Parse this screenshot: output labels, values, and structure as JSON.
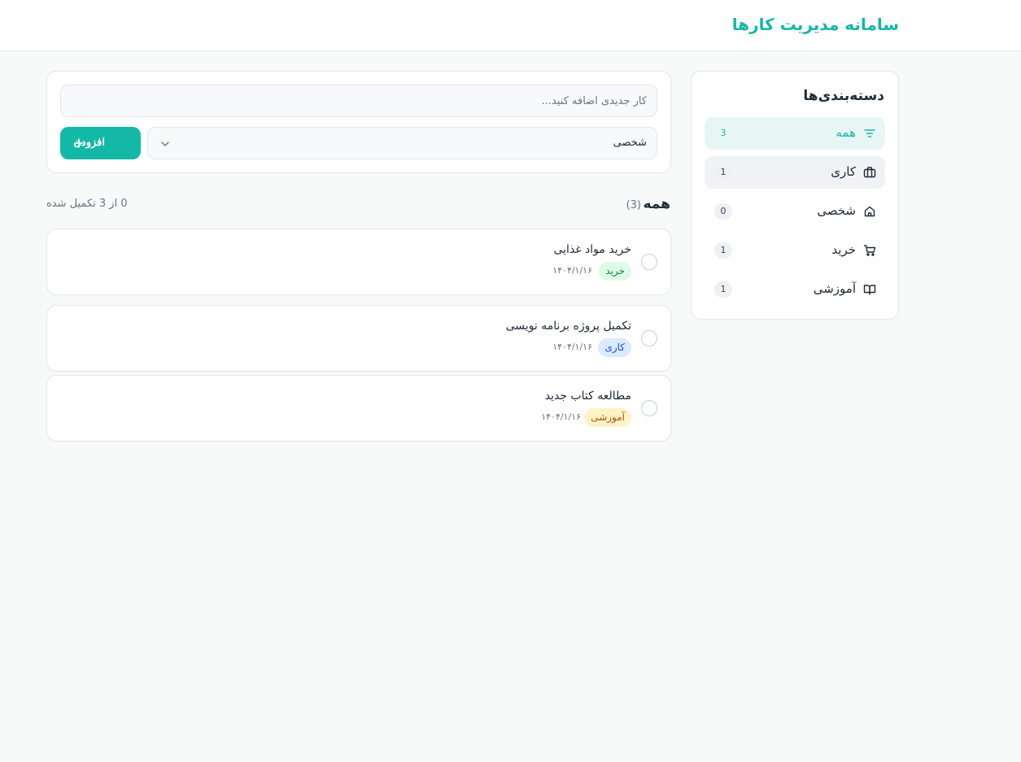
{
  "header": {
    "title": "سامانه مدیریت کارها"
  },
  "sidebar": {
    "title": "دسته‌بندی‌ها",
    "items": [
      {
        "label": "همه",
        "count": "3",
        "icon": "filter-icon",
        "state": "active"
      },
      {
        "label": "کاری",
        "count": "1",
        "icon": "briefcase-icon",
        "state": "hover"
      },
      {
        "label": "شخصی",
        "count": "0",
        "icon": "home-icon",
        "state": "normal"
      },
      {
        "label": "خرید",
        "count": "1",
        "icon": "shopping-cart-icon",
        "state": "normal"
      },
      {
        "label": "آموزشی",
        "count": "1",
        "icon": "book-open-icon",
        "state": "normal"
      }
    ]
  },
  "form": {
    "input_placeholder": "کار جدیدی اضافه کنید...",
    "input_value": "",
    "category_value": "شخصی",
    "add_label": "افزودن"
  },
  "list": {
    "title": "همه",
    "count": "(3)",
    "progress": "0 از 3 تکمیل شده"
  },
  "tasks": [
    {
      "text": "خرید مواد غذایی",
      "tag": "خرید",
      "date": "۱۴۰۴/۱/۱۶",
      "completed": false
    },
    {
      "text": "تکمیل پروژه برنامه نویسی",
      "tag": "کاری",
      "date": "۱۴۰۴/۱/۱۶",
      "completed": false
    },
    {
      "text": "مطالعه کتاب جدید",
      "tag": "آموزشی",
      "date": "۱۴۰۴/۱/۱۶",
      "completed": false
    }
  ],
  "colors": {
    "accent": "#14b8a6",
    "tag_shopping_bg": "#dcfce7",
    "tag_shopping_fg": "#15803d",
    "tag_work_bg": "#dbeafe",
    "tag_work_fg": "#1d4ed8",
    "tag_edu_bg": "#fef3c7",
    "tag_edu_fg": "#b45309"
  }
}
